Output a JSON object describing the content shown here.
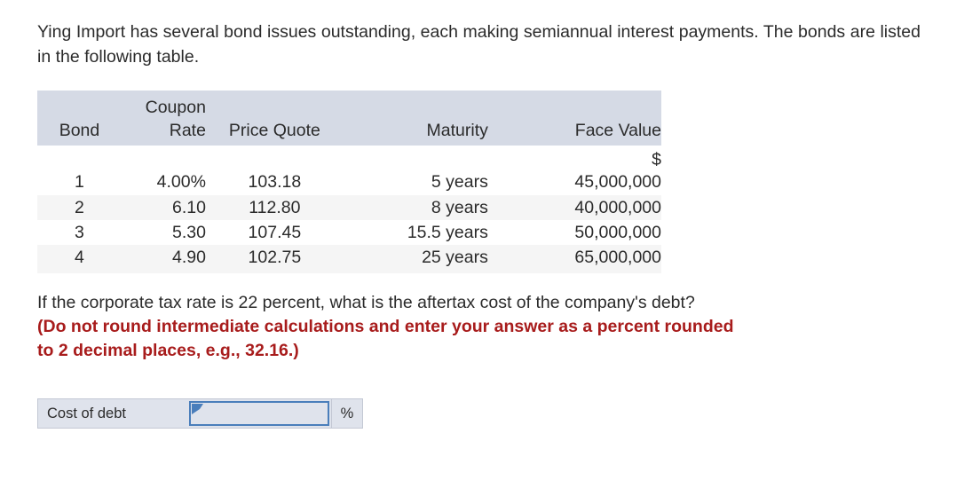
{
  "intro": {
    "text": "Ying Import has several bond issues outstanding, each making semiannual interest payments. The bonds are listed in the following table."
  },
  "table": {
    "headers": {
      "bond": "Bond",
      "coupon_line1": "Coupon",
      "coupon_line2": "Rate",
      "price_quote": "Price Quote",
      "maturity": "Maturity",
      "face_value": "Face Value"
    },
    "rows": [
      {
        "bond": "1",
        "coupon_rate": "4.00%",
        "price_quote": "103.18",
        "maturity": "5 years",
        "face_currency": "$",
        "face_value": "45,000,000"
      },
      {
        "bond": "2",
        "coupon_rate": "6.10",
        "price_quote": "112.80",
        "maturity": "8 years",
        "face_currency": "",
        "face_value": "40,000,000"
      },
      {
        "bond": "3",
        "coupon_rate": "5.30",
        "price_quote": "107.45",
        "maturity": "15.5 years",
        "face_currency": "",
        "face_value": "50,000,000"
      },
      {
        "bond": "4",
        "coupon_rate": "4.90",
        "price_quote": "102.75",
        "maturity": "25 years",
        "face_currency": "",
        "face_value": "65,000,000"
      }
    ]
  },
  "question": {
    "line1": "If the corporate tax rate is 22 percent, what is the aftertax cost of the company's debt?",
    "line2": "(Do not round intermediate calculations and enter your answer as a percent rounded",
    "line3": "to 2 decimal places, e.g., 32.16.)"
  },
  "answer": {
    "label": "Cost of debt",
    "value": "",
    "placeholder": "",
    "unit": "%"
  },
  "colors": {
    "header_bg": "#d5dae5",
    "row_alt_bg": "#f5f5f5",
    "red_text": "#a81c1c",
    "input_border": "#4a7ebb",
    "input_fill": "#dfe3ec",
    "widget_bg": "#dfe3ec"
  }
}
